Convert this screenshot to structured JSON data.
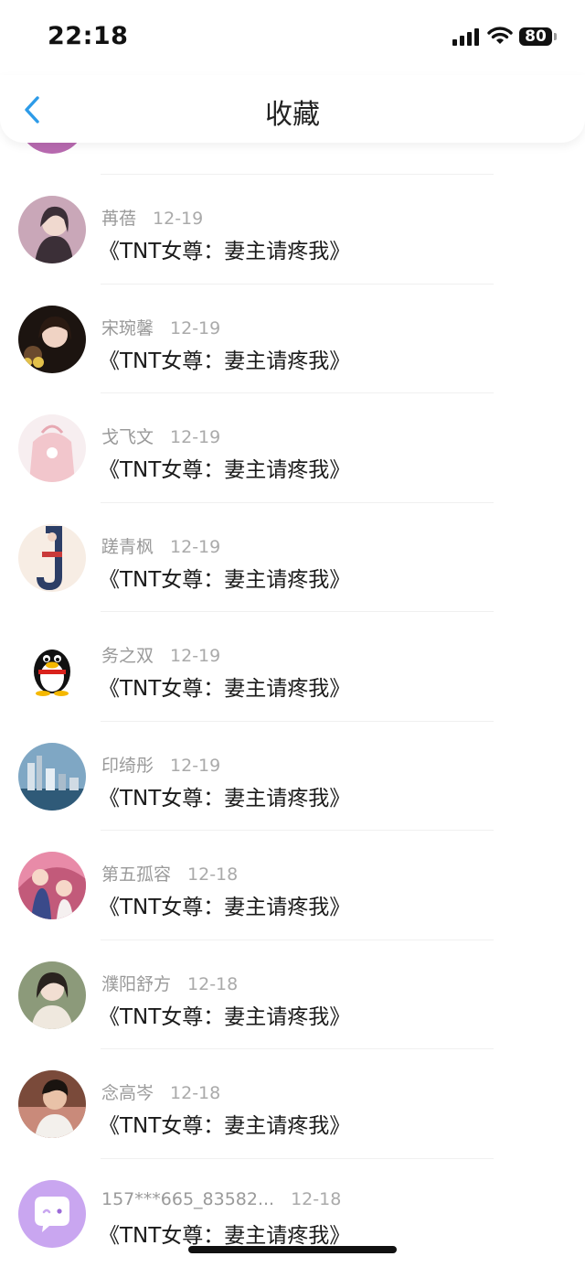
{
  "status_bar": {
    "time": "22:18",
    "battery": "80"
  },
  "header": {
    "title": "收藏"
  },
  "favorites": [
    {
      "name": "苒蓓",
      "date": "12-19",
      "book": "《TNT女尊：妻主请疼我》",
      "avatar_color": "#c9a7b8"
    },
    {
      "name": "宋琬馨",
      "date": "12-19",
      "book": "《TNT女尊：妻主请疼我》",
      "avatar_color": "#6b4a2e"
    },
    {
      "name": "戈飞文",
      "date": "12-19",
      "book": "《TNT女尊：妻主请疼我》",
      "avatar_color": "#f2c6cc"
    },
    {
      "name": "蹉青枫",
      "date": "12-19",
      "book": "《TNT女尊：妻主请疼我》",
      "avatar_color": "#f7ede4"
    },
    {
      "name": "务之双",
      "date": "12-19",
      "book": "《TNT女尊：妻主请疼我》",
      "avatar_color": "#ffffff"
    },
    {
      "name": "印绮彤",
      "date": "12-19",
      "book": "《TNT女尊：妻主请疼我》",
      "avatar_color": "#7fa7c4"
    },
    {
      "name": "第五孤容",
      "date": "12-18",
      "book": "《TNT女尊：妻主请疼我》",
      "avatar_color": "#c25a7a"
    },
    {
      "name": "濮阳舒方",
      "date": "12-18",
      "book": "《TNT女尊：妻主请疼我》",
      "avatar_color": "#8c9a7a"
    },
    {
      "name": "念高岑",
      "date": "12-18",
      "book": "《TNT女尊：妻主请疼我》",
      "avatar_color": "#7a4a3a"
    },
    {
      "name": "157***665_83582...",
      "date": "12-18",
      "book": "《TNT女尊：妻主请疼我》",
      "avatar_color": "#c9a6f0"
    }
  ]
}
